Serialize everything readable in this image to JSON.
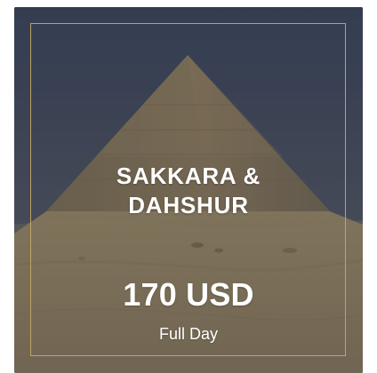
{
  "tour_card": {
    "title_line_1": "SAKKARA &",
    "title_line_2": "DAHSHUR",
    "price": "170 USD",
    "duration": "Full Day"
  },
  "theme": {
    "frame_color": "#c4a669",
    "text_color": "#ffffff",
    "overlay_color": "#3a3a4a"
  },
  "icons": {
    "background": "pyramid-image"
  }
}
